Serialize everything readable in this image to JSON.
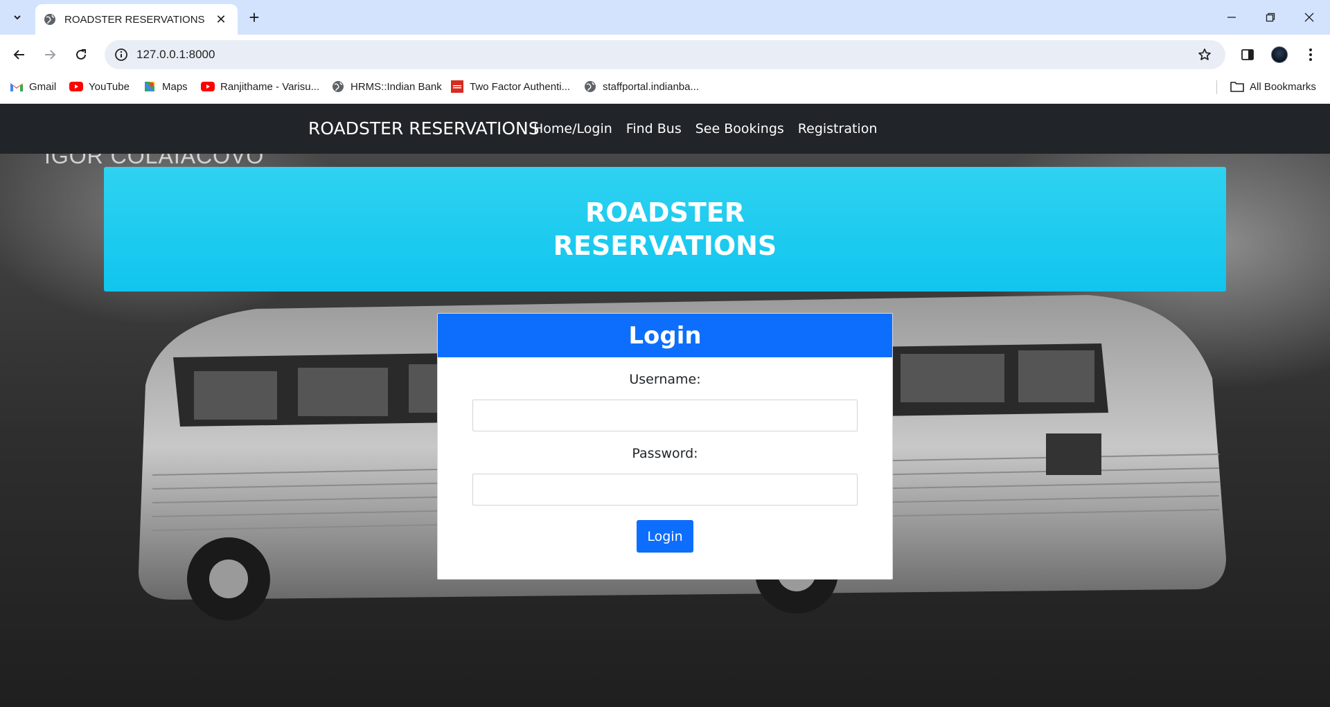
{
  "browser": {
    "tab": {
      "title": "ROADSTER RESERVATIONS"
    },
    "address": {
      "url": "127.0.0.1:8000"
    },
    "bookmarks": [
      {
        "label": "Gmail",
        "icon": "gmail-icon"
      },
      {
        "label": "YouTube",
        "icon": "youtube-icon"
      },
      {
        "label": "Maps",
        "icon": "maps-icon"
      },
      {
        "label": "Ranjithame - Varisu...",
        "icon": "youtube-icon"
      },
      {
        "label": "HRMS::Indian Bank",
        "icon": "globe-icon"
      },
      {
        "label": "Two Factor Authenti...",
        "icon": "red-shield-icon"
      },
      {
        "label": "staffportal.indianba...",
        "icon": "globe-icon"
      }
    ],
    "all_bookmarks": "All Bookmarks"
  },
  "page": {
    "watermark": "IGOR COLAIACOVO",
    "navbar": {
      "brand": "ROADSTER RESERVATIONS",
      "links": [
        "Home/Login",
        "Find Bus",
        "See Bookings",
        "Registration"
      ]
    },
    "hero": {
      "title": "ROADSTER RESERVATIONS"
    },
    "login": {
      "title": "Login",
      "username_label": "Username:",
      "username_value": "",
      "password_label": "Password:",
      "password_value": "",
      "submit_label": "Login"
    }
  },
  "colors": {
    "navbar": "#212529",
    "hero": "#13c6ee",
    "primary": "#0d6efd"
  }
}
